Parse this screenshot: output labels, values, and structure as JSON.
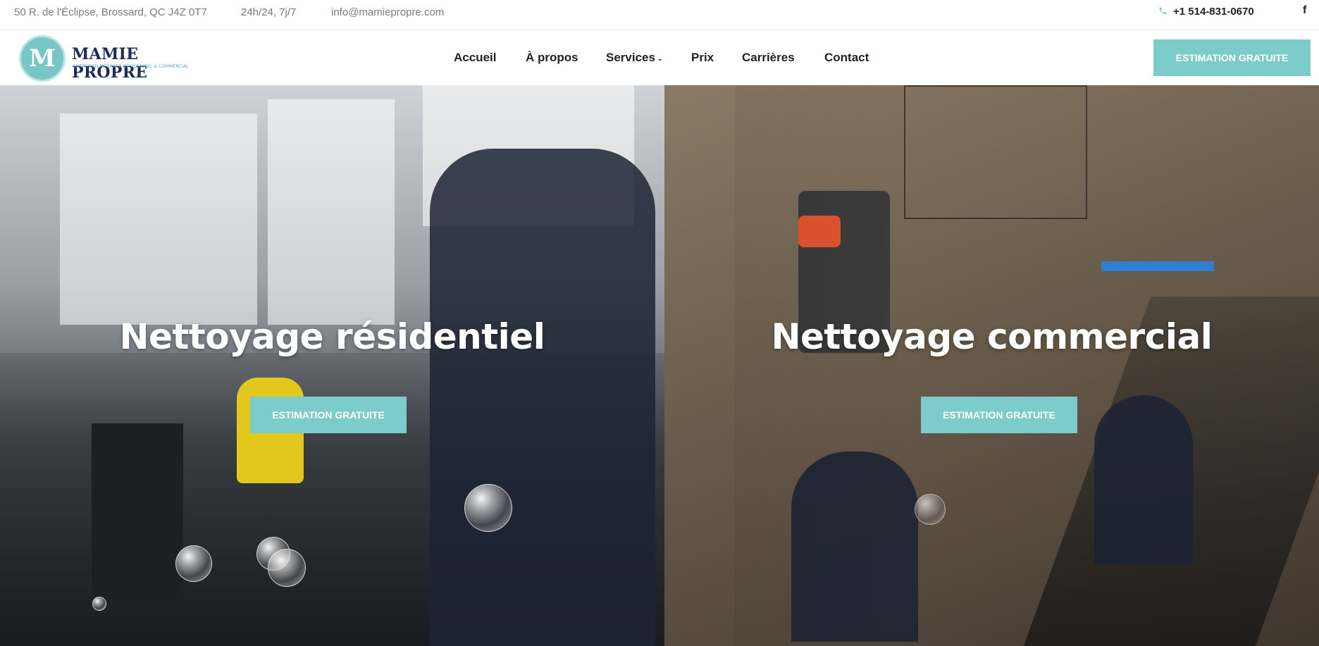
{
  "topbar": {
    "address": "50 R. de l'Éclipse, Brossard, QC J4Z 0T7",
    "hours": "24h/24, 7j/7",
    "email": "info@mamiepropre.com",
    "phone": "+1 514-831-0670",
    "facebook_glyph": "f"
  },
  "logo": {
    "monogram": "M",
    "name": "MAMIE PROPRE",
    "tagline": "ENTRETIEN MÉNAGER RÉSIDENTIEL & COMMERCIAL"
  },
  "nav": {
    "items": [
      "Accueil",
      "À propos",
      "Services",
      "Prix",
      "Carrières",
      "Contact"
    ],
    "services_caret": "⌄"
  },
  "header_cta": "ESTIMATION GRATUITE",
  "hero": {
    "left": {
      "title": "Nettoyage résidentiel",
      "cta": "ESTIMATION GRATUITE"
    },
    "right": {
      "title": "Nettoyage commercial",
      "cta": "ESTIMATION GRATUITE"
    }
  },
  "colors": {
    "accent": "#7ccccb",
    "logo_navy": "#1d2b57",
    "text_dark": "#222222",
    "text_muted": "#7a7a7a"
  },
  "icons": {
    "phone": "phone-icon",
    "facebook": "facebook-icon"
  }
}
